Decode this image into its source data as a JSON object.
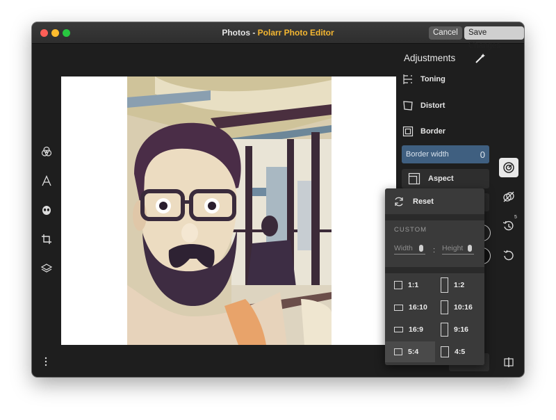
{
  "window": {
    "title_prefix": "Photos - ",
    "title_app": "Polarr Photo Editor",
    "cancel_label": "Cancel",
    "save_label": "Save Changes"
  },
  "left_toolbar": {
    "icons": [
      "filters-icon",
      "text-icon",
      "face-icon",
      "crop-icon",
      "layers-icon"
    ],
    "more_icon": "more-vertical-icon"
  },
  "adjustments": {
    "title": "Adjustments",
    "items": [
      {
        "label": "Toning",
        "icon": "toning-icon"
      },
      {
        "label": "Distort",
        "icon": "distort-icon"
      },
      {
        "label": "Border",
        "icon": "border-icon"
      }
    ],
    "border_width": {
      "label": "Border width",
      "value": "0"
    },
    "aspect": {
      "label": "Aspect",
      "icon": "aspect-icon"
    }
  },
  "aspect_menu": {
    "reset_label": "Reset",
    "custom_label": "CUSTOM",
    "width_placeholder": "Width",
    "height_placeholder": "Height",
    "separator": ":",
    "ratios_left": [
      "1:1",
      "16:10",
      "16:9",
      "5:4"
    ],
    "ratios_right": [
      "1:2",
      "10:16",
      "9:16",
      "4:5"
    ],
    "selected": "5:4"
  },
  "right_toolbar": {
    "icons": [
      "adjustments-icon",
      "mask-off-icon",
      "history-icon",
      "undo-icon"
    ],
    "history_badge": "5",
    "split_icon": "split-compare-icon"
  },
  "colors": {
    "accent_title": "#f5b731",
    "selected_field": "#3f5f80",
    "window_bg": "#1e1e1e"
  }
}
